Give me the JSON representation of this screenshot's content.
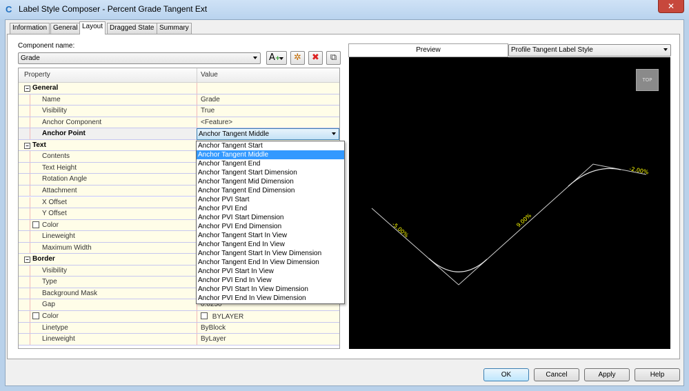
{
  "window": {
    "title": "Label Style Composer - Percent Grade Tangent Ext",
    "close": "✕"
  },
  "tabs": [
    {
      "label": "Information"
    },
    {
      "label": "General"
    },
    {
      "label": "Layout",
      "active": true
    },
    {
      "label": "Dragged State"
    },
    {
      "label": "Summary"
    }
  ],
  "component": {
    "label": "Component name:",
    "value": "Grade"
  },
  "toolbar": {
    "add_text": "A",
    "add_icon": "add-component-icon",
    "copy_icon": "copy-component-icon",
    "delete_icon": "delete-icon",
    "order_icon": "component-order-icon"
  },
  "grid": {
    "headers": {
      "property": "Property",
      "value": "Value"
    },
    "rows": [
      {
        "type": "cat",
        "label": "General"
      },
      {
        "label": "Name",
        "value": "Grade"
      },
      {
        "label": "Visibility",
        "value": "True"
      },
      {
        "label": "Anchor Component",
        "value": "<Feature>"
      },
      {
        "label": "Anchor Point",
        "value": "Anchor Tangent Middle",
        "selected": true
      },
      {
        "type": "cat",
        "label": "Text"
      },
      {
        "label": "Contents"
      },
      {
        "label": "Text Height"
      },
      {
        "label": "Rotation Angle"
      },
      {
        "label": "Attachment"
      },
      {
        "label": "X Offset"
      },
      {
        "label": "Y Offset"
      },
      {
        "label": "Color",
        "checkbox": true
      },
      {
        "label": "Lineweight"
      },
      {
        "label": "Maximum Width"
      },
      {
        "type": "cat",
        "label": "Border"
      },
      {
        "label": "Visibility"
      },
      {
        "label": "Type"
      },
      {
        "label": "Background Mask"
      },
      {
        "label": "Gap",
        "value": "0.0250\""
      },
      {
        "label": "Color",
        "checkbox": true,
        "value": "BYLAYER",
        "value_checkbox": true
      },
      {
        "label": "Linetype",
        "value": "ByBlock"
      },
      {
        "label": "Lineweight",
        "value": "ByLayer"
      }
    ]
  },
  "anchor_point_options": [
    "Anchor Tangent Start",
    "Anchor Tangent Middle",
    "Anchor Tangent End",
    "Anchor Tangent Start Dimension",
    "Anchor Tangent Mid Dimension",
    "Anchor Tangent End Dimension",
    "Anchor PVI Start",
    "Anchor PVI End",
    "Anchor PVI Start Dimension",
    "Anchor PVI End Dimension",
    "Anchor Tangent Start In View",
    "Anchor Tangent End In View",
    "Anchor Tangent Start In View Dimension",
    "Anchor Tangent End In View Dimension",
    "Anchor PVI Start In View",
    "Anchor PVI End In View",
    "Anchor PVI Start In View Dimension",
    "Anchor PVI End In View Dimension"
  ],
  "anchor_point_selected_index": 1,
  "preview": {
    "label": "Preview",
    "style": "Profile Tangent Label Style",
    "view_cube": "TOP",
    "grades": [
      "-5.00%",
      "9.00%",
      "-2.00%"
    ],
    "label_color": "#ffff00"
  },
  "buttons": {
    "ok": "OK",
    "cancel": "Cancel",
    "apply": "Apply",
    "help": "Help"
  }
}
